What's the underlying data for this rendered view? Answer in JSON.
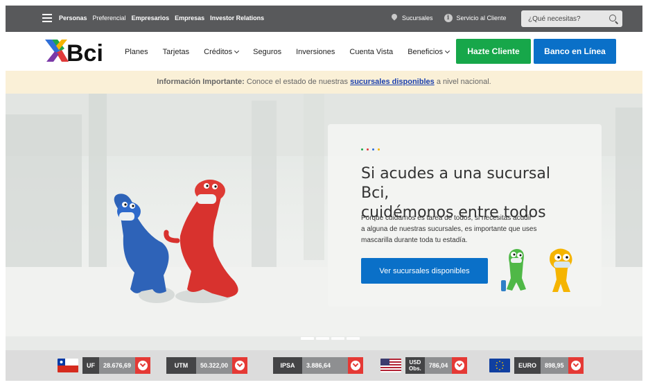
{
  "topbar": {
    "links": [
      "Personas",
      "Preferencial",
      "Empresarios",
      "Empresas",
      "Investor Relations"
    ],
    "sucursales": "Sucursales",
    "servicio": "Servicio al Cliente",
    "search_placeholder": "¿Qué necesitas?"
  },
  "nav": {
    "logo_text": "Bci",
    "items": [
      "Planes",
      "Tarjetas",
      "Créditos",
      "Seguros",
      "Inversiones",
      "Cuenta Vista",
      "Beneficios"
    ],
    "btn_cliente": "Hazte Cliente",
    "btn_banco": "Banco en Línea"
  },
  "notice": {
    "bold": "Información Importante:",
    "before": "Conoce el estado de nuestras",
    "link": "sucursales disponibles",
    "after": "a nivel nacional."
  },
  "hero": {
    "title_line1": "Si acudes a una sucursal Bci,",
    "title_line2": "cuidémonos entre todos",
    "body_line1": "Porque cuidarnos es tarea de todos, si necesitas acudir",
    "body_line2": "a alguna de nuestras sucursales, es importante que uses",
    "body_line3": "mascarilla durante toda tu estadía.",
    "cta": "Ver sucursales disponibles",
    "slides_total": 4,
    "slide_active": 1
  },
  "ticker": [
    {
      "label": "UF",
      "value": "28.676,69"
    },
    {
      "label": "UTM",
      "value": "50.322,00"
    },
    {
      "label": "IPSA",
      "value": "3.886,64"
    },
    {
      "label": "USD\nObs.",
      "label_l1": "USD",
      "label_l2": "Obs.",
      "value": "786,04"
    },
    {
      "label": "EURO",
      "value": "898,95"
    }
  ],
  "colors": {
    "topbar": "#58595b",
    "green": "#17a74a",
    "blue": "#0a70c8",
    "notice_bg": "#faf0d7",
    "ticker_red": "#e53935"
  }
}
